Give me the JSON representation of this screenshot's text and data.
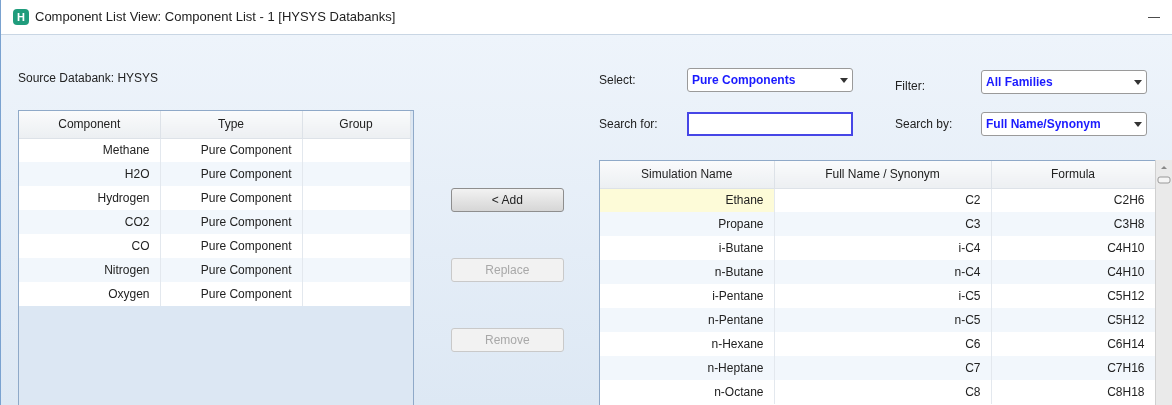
{
  "window": {
    "icon_letter": "H",
    "title": "Component List View: Component List - 1 [HYSYS Databanks]",
    "minimize": "—"
  },
  "source_databank": "Source Databank: HYSYS",
  "component_table": {
    "columns": [
      "Component",
      "Type",
      "Group"
    ],
    "rows": [
      {
        "component": "Methane",
        "type": "Pure Component"
      },
      {
        "component": "H2O",
        "type": "Pure Component"
      },
      {
        "component": "Hydrogen",
        "type": "Pure Component"
      },
      {
        "component": "CO2",
        "type": "Pure Component"
      },
      {
        "component": "CO",
        "type": "Pure Component"
      },
      {
        "component": "Nitrogen",
        "type": "Pure Component"
      },
      {
        "component": "Oxygen",
        "type": "Pure Component"
      }
    ]
  },
  "buttons": [
    {
      "label": "< Add",
      "disabled": false
    },
    {
      "label": "Replace",
      "disabled": true
    },
    {
      "label": "Remove",
      "disabled": true
    }
  ],
  "select": {
    "label": "Select:",
    "value": "Pure Components"
  },
  "filter": {
    "label": "Filter:",
    "value": "All Families"
  },
  "search_for": {
    "label": "Search for:",
    "focused": true
  },
  "search_by": {
    "label": "Search by:",
    "value": "Full Name/Synonym"
  },
  "library_table": {
    "columns": [
      "Simulation Name",
      "Full Name / Synonym",
      "Formula"
    ],
    "rows": [
      {
        "simulation_name": "Ethane",
        "full_name": "C2",
        "formula": "C2H6",
        "selected": true
      },
      {
        "simulation_name": "Propane",
        "full_name": "C3",
        "formula": "C3H8",
        "selected": false
      },
      {
        "simulation_name": "i-Butane",
        "full_name": "i-C4",
        "formula": "C4H10",
        "selected": false
      },
      {
        "simulation_name": "n-Butane",
        "full_name": "n-C4",
        "formula": "C4H10",
        "selected": false
      },
      {
        "simulation_name": "i-Pentane",
        "full_name": "i-C5",
        "formula": "C5H12",
        "selected": false
      },
      {
        "simulation_name": "n-Pentane",
        "full_name": "n-C5",
        "formula": "C5H12",
        "selected": false
      },
      {
        "simulation_name": "n-Hexane",
        "full_name": "C6",
        "formula": "C6H14",
        "selected": false
      },
      {
        "simulation_name": "n-Heptane",
        "full_name": "C7",
        "formula": "C7H16",
        "selected": false
      },
      {
        "simulation_name": "n-Octane",
        "full_name": "C8",
        "formula": "C8H18",
        "selected": false
      }
    ]
  }
}
